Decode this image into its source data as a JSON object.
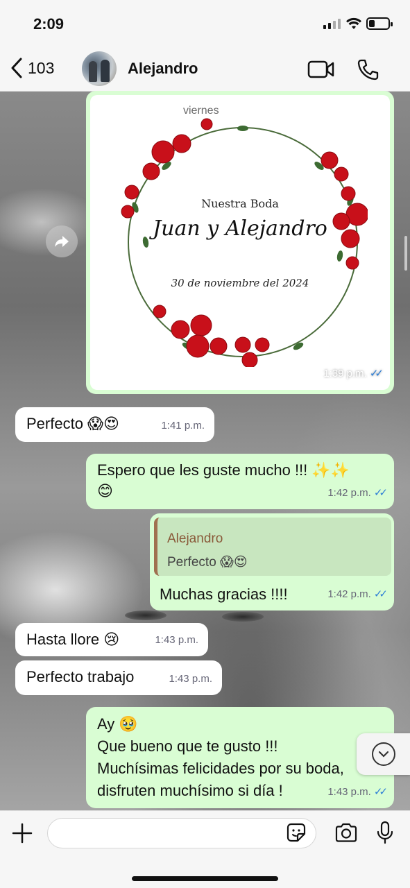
{
  "status_bar": {
    "time": "2:09"
  },
  "header": {
    "back_count": "103",
    "contact_name": "Alejandro",
    "icons": [
      "chevron-left-icon",
      "video-call-icon",
      "phone-icon"
    ]
  },
  "date_separator": "viernes",
  "image_message": {
    "invitation_title": "Nuestra Boda",
    "invitation_names": "Juan y Alejandro",
    "invitation_date": "30 de noviembre del 2024",
    "time": "1:39 p.m."
  },
  "messages": [
    {
      "direction": "in",
      "text": "Perfecto 😱😍",
      "time": "1:41 p.m."
    },
    {
      "direction": "out",
      "text": "Espero que les guste mucho !!! ✨✨",
      "text2": "😊",
      "time": "1:42 p.m."
    },
    {
      "direction": "out",
      "reply_author": "Alejandro",
      "reply_text": "Perfecto 😱😍",
      "text": "Muchas gracias !!!!",
      "time": "1:42 p.m."
    },
    {
      "direction": "in",
      "text": "Hasta llore 😢",
      "time": "1:43 p.m."
    },
    {
      "direction": "in",
      "text": "Perfecto trabajo",
      "time": "1:43 p.m."
    },
    {
      "direction": "out",
      "lines": [
        "Ay 🥹",
        "Que bueno que te gusto !!!",
        "Muchísimas felicidades por su boda,",
        "disfruten muchísimo si día !"
      ],
      "time": "1:43 p.m."
    }
  ],
  "input_bar": {
    "placeholder": "",
    "value": ""
  },
  "colors": {
    "outgoing_bubble": "#d9fdd3",
    "incoming_bubble": "#ffffff",
    "read_ticks": "#2e7fd6"
  }
}
